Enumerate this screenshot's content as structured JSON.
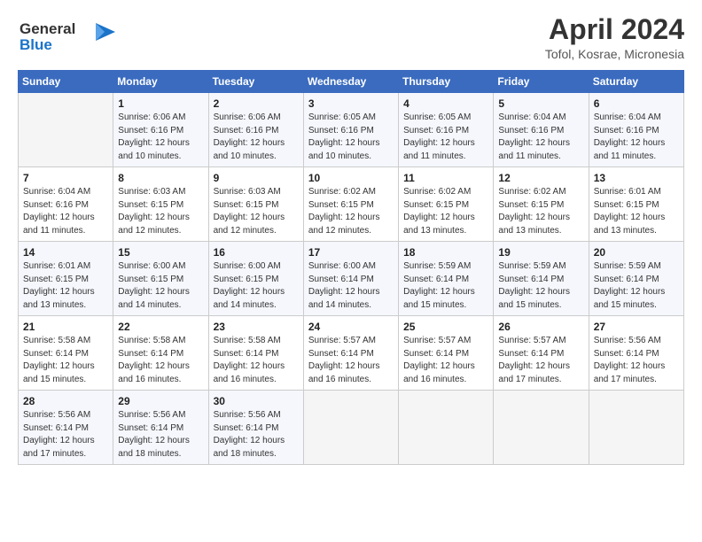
{
  "header": {
    "logo_line1": "General",
    "logo_line2": "Blue",
    "title": "April 2024",
    "subtitle": "Tofol, Kosrae, Micronesia"
  },
  "weekdays": [
    "Sunday",
    "Monday",
    "Tuesday",
    "Wednesday",
    "Thursday",
    "Friday",
    "Saturday"
  ],
  "weeks": [
    [
      {
        "day": "",
        "detail": ""
      },
      {
        "day": "1",
        "detail": "Sunrise: 6:06 AM\nSunset: 6:16 PM\nDaylight: 12 hours\nand 10 minutes."
      },
      {
        "day": "2",
        "detail": "Sunrise: 6:06 AM\nSunset: 6:16 PM\nDaylight: 12 hours\nand 10 minutes."
      },
      {
        "day": "3",
        "detail": "Sunrise: 6:05 AM\nSunset: 6:16 PM\nDaylight: 12 hours\nand 10 minutes."
      },
      {
        "day": "4",
        "detail": "Sunrise: 6:05 AM\nSunset: 6:16 PM\nDaylight: 12 hours\nand 11 minutes."
      },
      {
        "day": "5",
        "detail": "Sunrise: 6:04 AM\nSunset: 6:16 PM\nDaylight: 12 hours\nand 11 minutes."
      },
      {
        "day": "6",
        "detail": "Sunrise: 6:04 AM\nSunset: 6:16 PM\nDaylight: 12 hours\nand 11 minutes."
      }
    ],
    [
      {
        "day": "7",
        "detail": "Sunrise: 6:04 AM\nSunset: 6:16 PM\nDaylight: 12 hours\nand 11 minutes."
      },
      {
        "day": "8",
        "detail": "Sunrise: 6:03 AM\nSunset: 6:15 PM\nDaylight: 12 hours\nand 12 minutes."
      },
      {
        "day": "9",
        "detail": "Sunrise: 6:03 AM\nSunset: 6:15 PM\nDaylight: 12 hours\nand 12 minutes."
      },
      {
        "day": "10",
        "detail": "Sunrise: 6:02 AM\nSunset: 6:15 PM\nDaylight: 12 hours\nand 12 minutes."
      },
      {
        "day": "11",
        "detail": "Sunrise: 6:02 AM\nSunset: 6:15 PM\nDaylight: 12 hours\nand 13 minutes."
      },
      {
        "day": "12",
        "detail": "Sunrise: 6:02 AM\nSunset: 6:15 PM\nDaylight: 12 hours\nand 13 minutes."
      },
      {
        "day": "13",
        "detail": "Sunrise: 6:01 AM\nSunset: 6:15 PM\nDaylight: 12 hours\nand 13 minutes."
      }
    ],
    [
      {
        "day": "14",
        "detail": "Sunrise: 6:01 AM\nSunset: 6:15 PM\nDaylight: 12 hours\nand 13 minutes."
      },
      {
        "day": "15",
        "detail": "Sunrise: 6:00 AM\nSunset: 6:15 PM\nDaylight: 12 hours\nand 14 minutes."
      },
      {
        "day": "16",
        "detail": "Sunrise: 6:00 AM\nSunset: 6:15 PM\nDaylight: 12 hours\nand 14 minutes."
      },
      {
        "day": "17",
        "detail": "Sunrise: 6:00 AM\nSunset: 6:14 PM\nDaylight: 12 hours\nand 14 minutes."
      },
      {
        "day": "18",
        "detail": "Sunrise: 5:59 AM\nSunset: 6:14 PM\nDaylight: 12 hours\nand 15 minutes."
      },
      {
        "day": "19",
        "detail": "Sunrise: 5:59 AM\nSunset: 6:14 PM\nDaylight: 12 hours\nand 15 minutes."
      },
      {
        "day": "20",
        "detail": "Sunrise: 5:59 AM\nSunset: 6:14 PM\nDaylight: 12 hours\nand 15 minutes."
      }
    ],
    [
      {
        "day": "21",
        "detail": "Sunrise: 5:58 AM\nSunset: 6:14 PM\nDaylight: 12 hours\nand 15 minutes."
      },
      {
        "day": "22",
        "detail": "Sunrise: 5:58 AM\nSunset: 6:14 PM\nDaylight: 12 hours\nand 16 minutes."
      },
      {
        "day": "23",
        "detail": "Sunrise: 5:58 AM\nSunset: 6:14 PM\nDaylight: 12 hours\nand 16 minutes."
      },
      {
        "day": "24",
        "detail": "Sunrise: 5:57 AM\nSunset: 6:14 PM\nDaylight: 12 hours\nand 16 minutes."
      },
      {
        "day": "25",
        "detail": "Sunrise: 5:57 AM\nSunset: 6:14 PM\nDaylight: 12 hours\nand 16 minutes."
      },
      {
        "day": "26",
        "detail": "Sunrise: 5:57 AM\nSunset: 6:14 PM\nDaylight: 12 hours\nand 17 minutes."
      },
      {
        "day": "27",
        "detail": "Sunrise: 5:56 AM\nSunset: 6:14 PM\nDaylight: 12 hours\nand 17 minutes."
      }
    ],
    [
      {
        "day": "28",
        "detail": "Sunrise: 5:56 AM\nSunset: 6:14 PM\nDaylight: 12 hours\nand 17 minutes."
      },
      {
        "day": "29",
        "detail": "Sunrise: 5:56 AM\nSunset: 6:14 PM\nDaylight: 12 hours\nand 18 minutes."
      },
      {
        "day": "30",
        "detail": "Sunrise: 5:56 AM\nSunset: 6:14 PM\nDaylight: 12 hours\nand 18 minutes."
      },
      {
        "day": "",
        "detail": ""
      },
      {
        "day": "",
        "detail": ""
      },
      {
        "day": "",
        "detail": ""
      },
      {
        "day": "",
        "detail": ""
      }
    ]
  ]
}
